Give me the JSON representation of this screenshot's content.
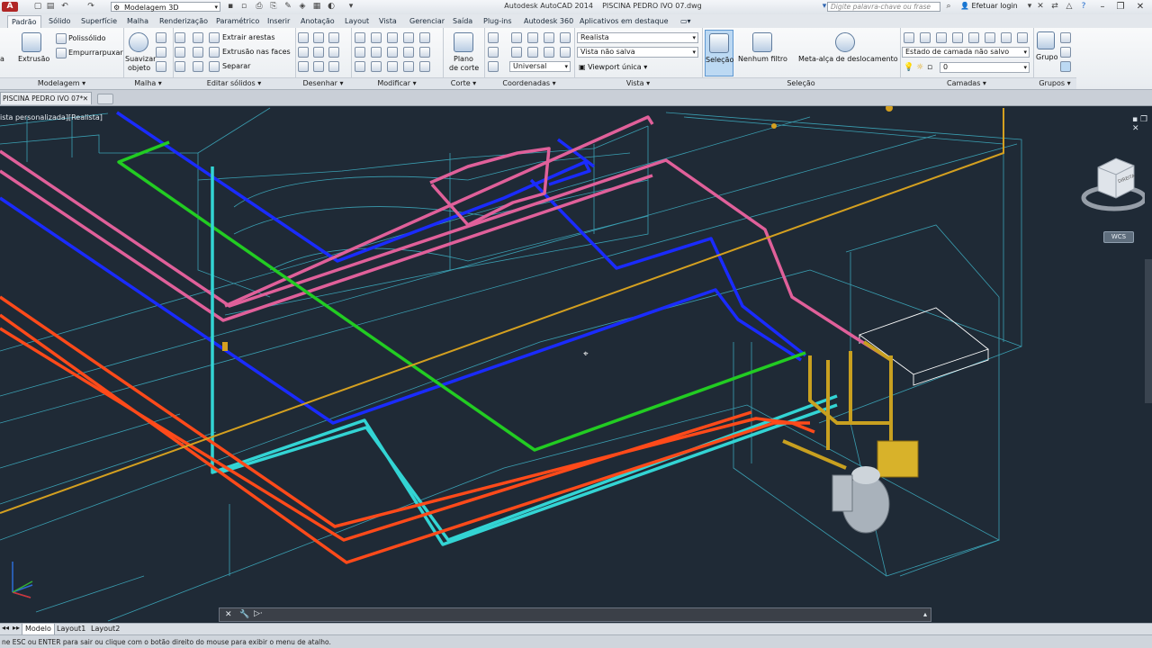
{
  "title_bar": {
    "app_title": "Autodesk AutoCAD 2014",
    "file_name": "PISCINA PEDRO IVO 07.dwg",
    "workspace": "Modelagem 3D",
    "search_placeholder": "Digite palavra-chave ou frase",
    "login_label": "Efetuar login",
    "window_controls": [
      "minimize-icon",
      "restore-icon",
      "close-icon"
    ]
  },
  "ribbon_tabs": [
    "Padrão",
    "Sólido",
    "Superfície",
    "Malha",
    "Renderização",
    "Paramétrico",
    "Inserir",
    "Anotação",
    "Layout",
    "Vista",
    "Gerenciar",
    "Saída",
    "Plug-ins",
    "Autodesk 360",
    "Aplicativos em destaque"
  ],
  "active_tab": "Padrão",
  "ribbon": {
    "modelagem": {
      "title": "Modelagem",
      "extrusao": "Extrusão",
      "polissolido": "Polissólido",
      "empurrarpuxar": "Empurrarpuxar"
    },
    "malha": {
      "title": "Malha",
      "suavizar_1": "Suavizar",
      "suavizar_2": "objeto"
    },
    "editar_solidos": {
      "title": "Editar sólidos",
      "extrair_arestas": "Extrair arestas",
      "extrusao_faces": "Extrusão nas faces",
      "separar": "Separar"
    },
    "desenhar": {
      "title": "Desenhar"
    },
    "modificar": {
      "title": "Modificar"
    },
    "corte": {
      "title": "Corte",
      "plano_1": "Plano",
      "plano_2": "de corte"
    },
    "coordenadas": {
      "title": "Coordenadas",
      "universal": "Universal"
    },
    "vista": {
      "title": "Vista",
      "visual_style": "Realista",
      "named_view": "Vista não salva",
      "viewport": "Viewport única"
    },
    "selecao": {
      "title": "Seleção",
      "selecao_btn": "Seleção",
      "nenhum_filtro": "Nenhum filtro",
      "meta_alca": "Meta-alça de deslocamento"
    },
    "camadas": {
      "title": "Camadas",
      "layer_state": "Estado de camada não salvo",
      "layer_current": "0"
    },
    "grupos": {
      "title": "Grupos",
      "grupo": "Grupo"
    }
  },
  "document_tab": {
    "name": "PISCINA PEDRO IVO 07*"
  },
  "viewport": {
    "label": "ista personalizada][Realista]",
    "ucs_label": "WCS",
    "viewcube_label": "DIREITA"
  },
  "layout_tabs": [
    "Modelo",
    "Layout1",
    "Layout2"
  ],
  "active_layout": "Modelo",
  "status": {
    "prompt": "ne ESC ou ENTER para sair ou clique com o botão direito do mouse para exibir o menu de atalho."
  },
  "colors": {
    "viewport_bg": "#1f2a36",
    "pipe_blue": "#1a2bff",
    "pipe_pink": "#e0609a",
    "pipe_green": "#22cc22",
    "pipe_cyan": "#33d4d4",
    "pipe_orange": "#ff4a1a",
    "pipe_yellow": "#d4a020",
    "wireframe": "#3fb4c8"
  }
}
